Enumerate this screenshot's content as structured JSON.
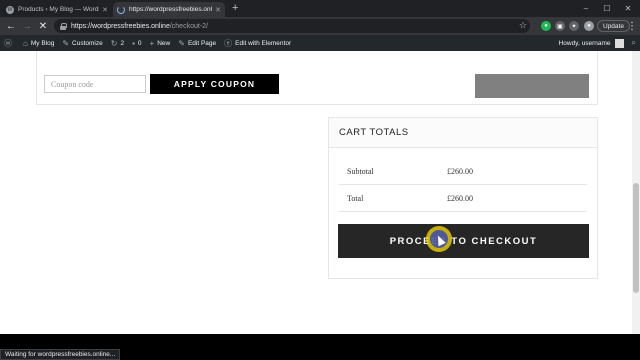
{
  "browser": {
    "tabs": [
      {
        "title": "Products ‹ My Blog — WordPress"
      },
      {
        "title": "https://wordpressfreebies.online/c"
      }
    ],
    "new_tab": "+",
    "window_controls": [
      "–",
      "☐",
      "✕"
    ],
    "url_host": "https://wordpressfreebies.online",
    "url_path": "/checkout-2/",
    "update_label": "Update",
    "status_text": "Waiting for wordpressfreebies.online..."
  },
  "adminbar": {
    "site_name": "My Blog",
    "customize": "Customize",
    "updates_count": "2",
    "comments_count": "0",
    "new": "New",
    "edit_page": "Edit Page",
    "elementor": "Edit with Elementor",
    "greeting": "Howdy, username"
  },
  "coupon": {
    "placeholder": "Coupon code",
    "apply_label": "APPLY COUPON"
  },
  "cart_totals": {
    "heading": "CART TOTALS",
    "rows": [
      {
        "label": "Subtotal",
        "value": "£260.00"
      },
      {
        "label": "Total",
        "value": "£260.00"
      }
    ],
    "checkout_label": "PROCEED TO CHECKOUT"
  },
  "colors": {
    "admin_bar": "#23282d",
    "button_dark": "#262626",
    "update_cart_gray": "#808080"
  }
}
